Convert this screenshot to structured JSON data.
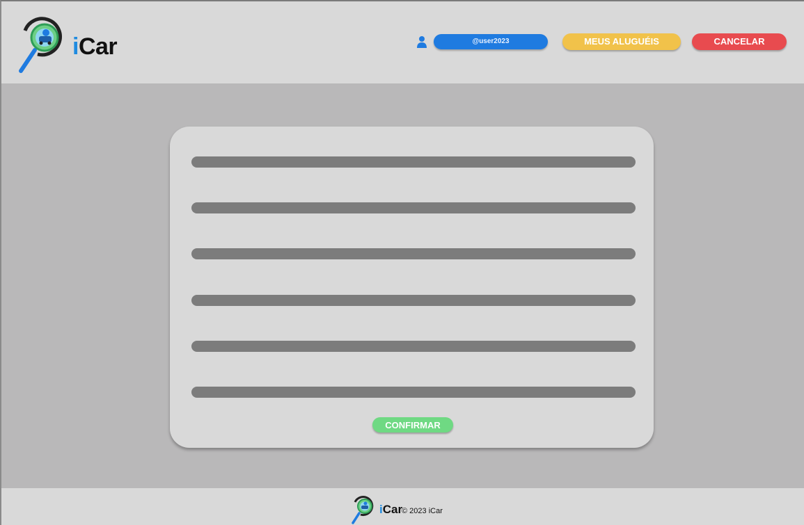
{
  "header": {
    "brand_i": "i",
    "brand_rest": "Car",
    "username": "@user2023",
    "rentals_label": "MEUS ALUGUÉIS",
    "cancel_label": "CANCELAR"
  },
  "form": {
    "field_count": 6,
    "confirm_label": "CONFIRMAR"
  },
  "footer": {
    "brand_i": "i",
    "brand_rest": "Car",
    "copyright": "© 2023 iCar"
  },
  "colors": {
    "header_bg": "#d9d9d9",
    "page_bg": "#b9b8b9",
    "user_pill": "#1f7be0",
    "rentals_button": "#f1c24a",
    "cancel_button": "#e84b4f",
    "confirm_button": "#6fd983",
    "field_bar": "#7c7c7c",
    "brand_blue": "#1f8be0"
  },
  "icons": {
    "logo": "magnifier-car-logo-icon",
    "user": "user-icon"
  }
}
